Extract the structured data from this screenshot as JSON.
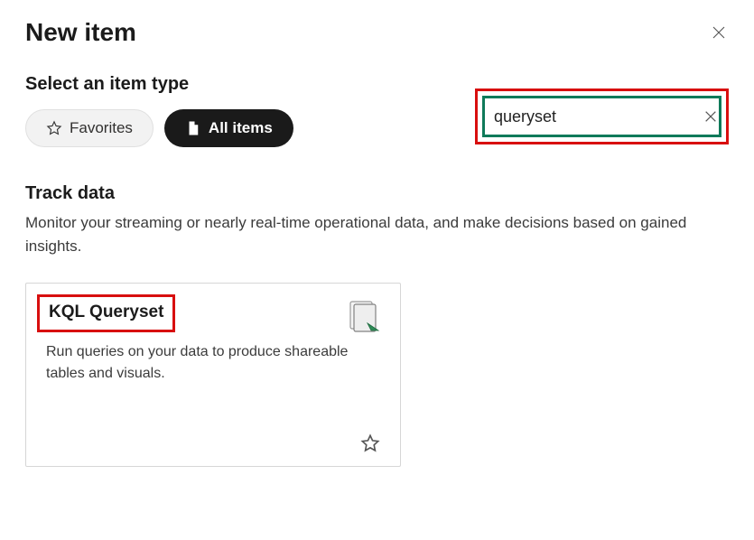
{
  "header": {
    "title": "New item"
  },
  "filter": {
    "section_label": "Select an item type",
    "favorites_label": "Favorites",
    "all_items_label": "All items"
  },
  "search": {
    "value": "queryset",
    "placeholder": ""
  },
  "category": {
    "title": "Track data",
    "description": "Monitor your streaming or nearly real-time operational data, and make decisions based on gained insights."
  },
  "card": {
    "title": "KQL Queryset",
    "description": "Run queries on your data to produce shareable tables and visuals."
  }
}
